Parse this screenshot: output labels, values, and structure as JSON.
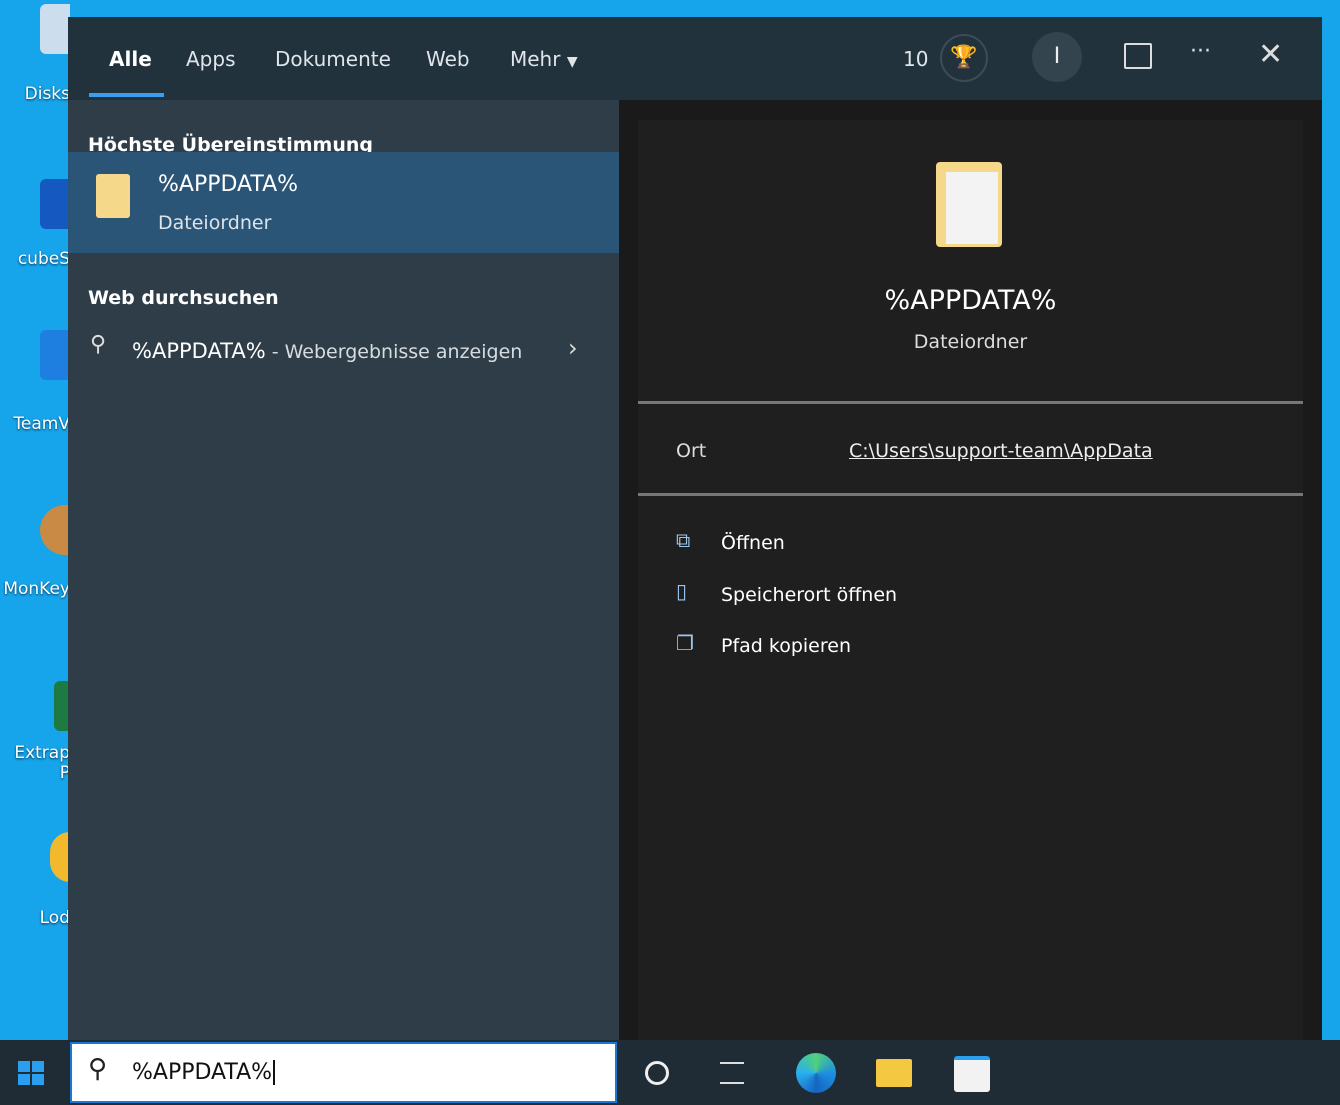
{
  "desktop": {
    "icons": [
      "Disks",
      "cubeS",
      "TeamV",
      "MonKey",
      "Extrap",
      "P",
      "Lod"
    ]
  },
  "header": {
    "tabs": [
      "Alle",
      "Apps",
      "Dokumente",
      "Web",
      "Mehr"
    ],
    "points": "10",
    "avatar_initial": "I"
  },
  "left": {
    "best_match_heading": "Höchste Übereinstimmung",
    "best_match_title": "%APPDATA%",
    "best_match_type": "Dateiordner",
    "web_heading": "Web durchsuchen",
    "web_query": "%APPDATA%",
    "web_suffix": " - Webergebnisse anzeigen"
  },
  "right": {
    "title": "%APPDATA%",
    "type": "Dateiordner",
    "location_label": "Ort",
    "location_value": "C:\\Users\\support-team\\AppData",
    "actions": [
      "Öffnen",
      "Speicherort öffnen",
      "Pfad kopieren"
    ]
  },
  "taskbar": {
    "search_value": "%APPDATA%"
  }
}
